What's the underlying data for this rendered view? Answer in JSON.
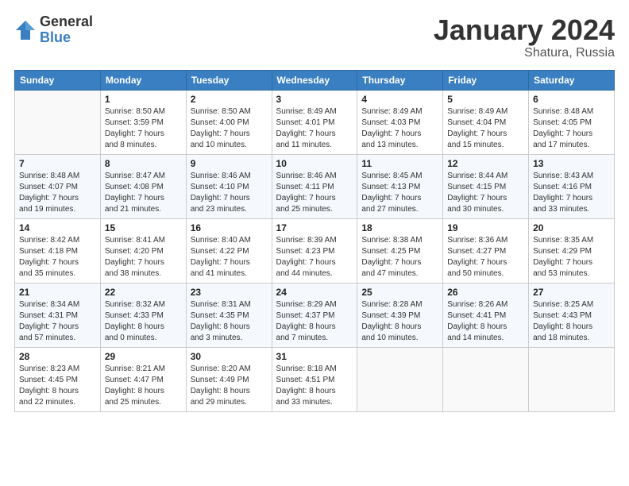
{
  "logo": {
    "general": "General",
    "blue": "Blue"
  },
  "title": "January 2024",
  "location": "Shatura, Russia",
  "days_header": [
    "Sunday",
    "Monday",
    "Tuesday",
    "Wednesday",
    "Thursday",
    "Friday",
    "Saturday"
  ],
  "weeks": [
    [
      {
        "day": "",
        "info": ""
      },
      {
        "day": "1",
        "info": "Sunrise: 8:50 AM\nSunset: 3:59 PM\nDaylight: 7 hours\nand 8 minutes."
      },
      {
        "day": "2",
        "info": "Sunrise: 8:50 AM\nSunset: 4:00 PM\nDaylight: 7 hours\nand 10 minutes."
      },
      {
        "day": "3",
        "info": "Sunrise: 8:49 AM\nSunset: 4:01 PM\nDaylight: 7 hours\nand 11 minutes."
      },
      {
        "day": "4",
        "info": "Sunrise: 8:49 AM\nSunset: 4:03 PM\nDaylight: 7 hours\nand 13 minutes."
      },
      {
        "day": "5",
        "info": "Sunrise: 8:49 AM\nSunset: 4:04 PM\nDaylight: 7 hours\nand 15 minutes."
      },
      {
        "day": "6",
        "info": "Sunrise: 8:48 AM\nSunset: 4:05 PM\nDaylight: 7 hours\nand 17 minutes."
      }
    ],
    [
      {
        "day": "7",
        "info": "Sunrise: 8:48 AM\nSunset: 4:07 PM\nDaylight: 7 hours\nand 19 minutes."
      },
      {
        "day": "8",
        "info": "Sunrise: 8:47 AM\nSunset: 4:08 PM\nDaylight: 7 hours\nand 21 minutes."
      },
      {
        "day": "9",
        "info": "Sunrise: 8:46 AM\nSunset: 4:10 PM\nDaylight: 7 hours\nand 23 minutes."
      },
      {
        "day": "10",
        "info": "Sunrise: 8:46 AM\nSunset: 4:11 PM\nDaylight: 7 hours\nand 25 minutes."
      },
      {
        "day": "11",
        "info": "Sunrise: 8:45 AM\nSunset: 4:13 PM\nDaylight: 7 hours\nand 27 minutes."
      },
      {
        "day": "12",
        "info": "Sunrise: 8:44 AM\nSunset: 4:15 PM\nDaylight: 7 hours\nand 30 minutes."
      },
      {
        "day": "13",
        "info": "Sunrise: 8:43 AM\nSunset: 4:16 PM\nDaylight: 7 hours\nand 33 minutes."
      }
    ],
    [
      {
        "day": "14",
        "info": "Sunrise: 8:42 AM\nSunset: 4:18 PM\nDaylight: 7 hours\nand 35 minutes."
      },
      {
        "day": "15",
        "info": "Sunrise: 8:41 AM\nSunset: 4:20 PM\nDaylight: 7 hours\nand 38 minutes."
      },
      {
        "day": "16",
        "info": "Sunrise: 8:40 AM\nSunset: 4:22 PM\nDaylight: 7 hours\nand 41 minutes."
      },
      {
        "day": "17",
        "info": "Sunrise: 8:39 AM\nSunset: 4:23 PM\nDaylight: 7 hours\nand 44 minutes."
      },
      {
        "day": "18",
        "info": "Sunrise: 8:38 AM\nSunset: 4:25 PM\nDaylight: 7 hours\nand 47 minutes."
      },
      {
        "day": "19",
        "info": "Sunrise: 8:36 AM\nSunset: 4:27 PM\nDaylight: 7 hours\nand 50 minutes."
      },
      {
        "day": "20",
        "info": "Sunrise: 8:35 AM\nSunset: 4:29 PM\nDaylight: 7 hours\nand 53 minutes."
      }
    ],
    [
      {
        "day": "21",
        "info": "Sunrise: 8:34 AM\nSunset: 4:31 PM\nDaylight: 7 hours\nand 57 minutes."
      },
      {
        "day": "22",
        "info": "Sunrise: 8:32 AM\nSunset: 4:33 PM\nDaylight: 8 hours\nand 0 minutes."
      },
      {
        "day": "23",
        "info": "Sunrise: 8:31 AM\nSunset: 4:35 PM\nDaylight: 8 hours\nand 3 minutes."
      },
      {
        "day": "24",
        "info": "Sunrise: 8:29 AM\nSunset: 4:37 PM\nDaylight: 8 hours\nand 7 minutes."
      },
      {
        "day": "25",
        "info": "Sunrise: 8:28 AM\nSunset: 4:39 PM\nDaylight: 8 hours\nand 10 minutes."
      },
      {
        "day": "26",
        "info": "Sunrise: 8:26 AM\nSunset: 4:41 PM\nDaylight: 8 hours\nand 14 minutes."
      },
      {
        "day": "27",
        "info": "Sunrise: 8:25 AM\nSunset: 4:43 PM\nDaylight: 8 hours\nand 18 minutes."
      }
    ],
    [
      {
        "day": "28",
        "info": "Sunrise: 8:23 AM\nSunset: 4:45 PM\nDaylight: 8 hours\nand 22 minutes."
      },
      {
        "day": "29",
        "info": "Sunrise: 8:21 AM\nSunset: 4:47 PM\nDaylight: 8 hours\nand 25 minutes."
      },
      {
        "day": "30",
        "info": "Sunrise: 8:20 AM\nSunset: 4:49 PM\nDaylight: 8 hours\nand 29 minutes."
      },
      {
        "day": "31",
        "info": "Sunrise: 8:18 AM\nSunset: 4:51 PM\nDaylight: 8 hours\nand 33 minutes."
      },
      {
        "day": "",
        "info": ""
      },
      {
        "day": "",
        "info": ""
      },
      {
        "day": "",
        "info": ""
      }
    ]
  ]
}
